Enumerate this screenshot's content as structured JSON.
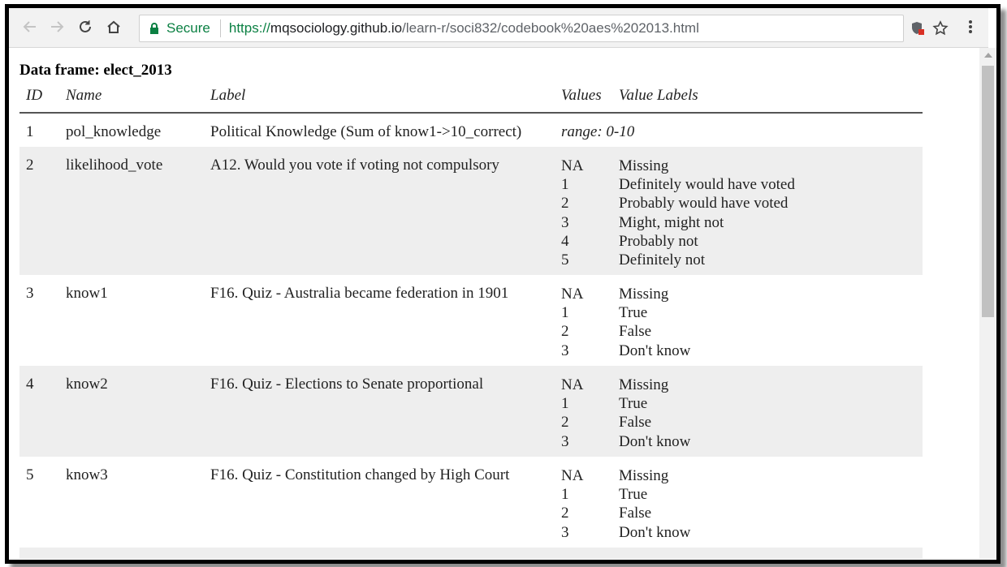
{
  "browser": {
    "secure_label": "Secure",
    "url_scheme": "https://",
    "url_host": "mqsociology.github.io",
    "url_path": "/learn-r/soci832/codebook%20aes%202013.html",
    "accent_secure": "#0b8043"
  },
  "page": {
    "title": "Data frame: elect_2013",
    "headers": {
      "id": "ID",
      "name": "Name",
      "label": "Label",
      "values": "Values",
      "value_labels": "Value Labels"
    },
    "rows": [
      {
        "id": "1",
        "name": "pol_knowledge",
        "label": "Political Knowledge (Sum of know1->10_correct)",
        "range": "range: 0-10"
      },
      {
        "id": "2",
        "name": "likelihood_vote",
        "label": "A12. Would you vote if voting not compulsory",
        "values": [
          "NA",
          "1",
          "2",
          "3",
          "4",
          "5"
        ],
        "value_labels": [
          "Missing",
          "Definitely would have voted",
          "Probably would have voted",
          "Might, might not",
          "Probably not",
          "Definitely not"
        ]
      },
      {
        "id": "3",
        "name": "know1",
        "label": "F16. Quiz - Australia became federation in 1901",
        "values": [
          "NA",
          "1",
          "2",
          "3"
        ],
        "value_labels": [
          "Missing",
          "True",
          "False",
          "Don't know"
        ]
      },
      {
        "id": "4",
        "name": "know2",
        "label": "F16. Quiz - Elections to Senate proportional",
        "values": [
          "NA",
          "1",
          "2",
          "3"
        ],
        "value_labels": [
          "Missing",
          "True",
          "False",
          "Don't know"
        ]
      },
      {
        "id": "5",
        "name": "know3",
        "label": "F16. Quiz - Constitution changed by High Court",
        "values": [
          "NA",
          "1",
          "2",
          "3"
        ],
        "value_labels": [
          "Missing",
          "True",
          "False",
          "Don't know"
        ]
      }
    ]
  }
}
